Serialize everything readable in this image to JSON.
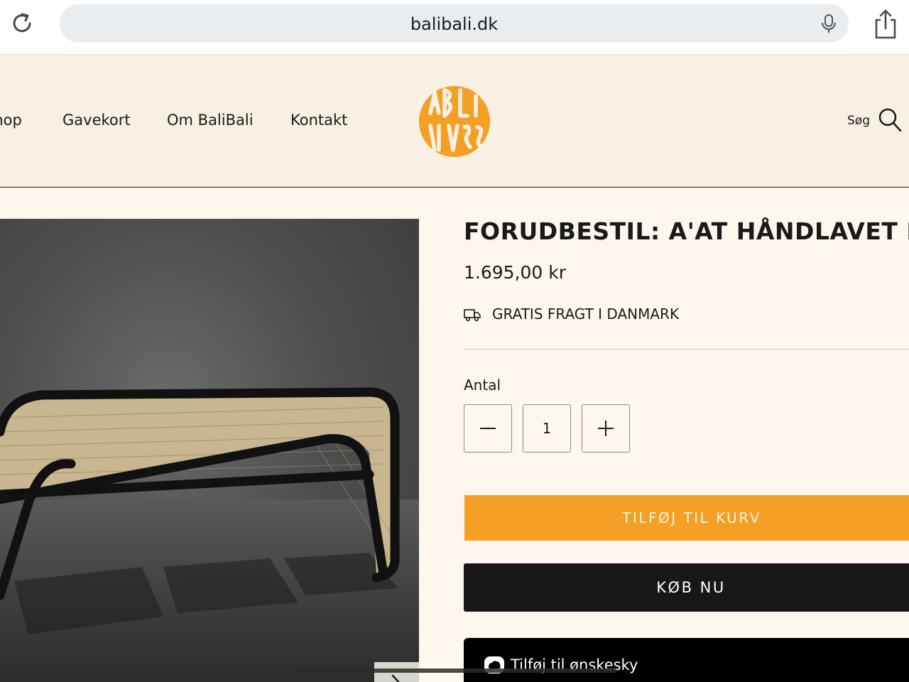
{
  "browser": {
    "url": "balibali.dk"
  },
  "header": {
    "nav": [
      "Shop",
      "Gavekort",
      "Om BaliBali",
      "Kontakt"
    ],
    "logo_text": "BALI BALI",
    "search_label": "Søg"
  },
  "product": {
    "title": "FORUDBESTIL: A'AT HÅNDLAVET BÆNK",
    "price": "1.695,00 kr",
    "shipping": "GRATIS FRAGT I DANMARK",
    "quantity_label": "Antal",
    "quantity": "1",
    "add_to_cart": "TILFØJ TIL KURV",
    "buy_now": "KØB NU",
    "wishlist": "Tilføj til ønskesky"
  },
  "colors": {
    "accent": "#f4a024",
    "header_bg": "#f8f0e3",
    "page_bg": "#fdf7ee",
    "dark_button": "#171717"
  },
  "icons": [
    "reload-icon",
    "microphone-icon",
    "share-icon",
    "search-icon",
    "truck-icon",
    "minus-icon",
    "plus-icon",
    "chevron-right-icon",
    "cloud-icon"
  ]
}
